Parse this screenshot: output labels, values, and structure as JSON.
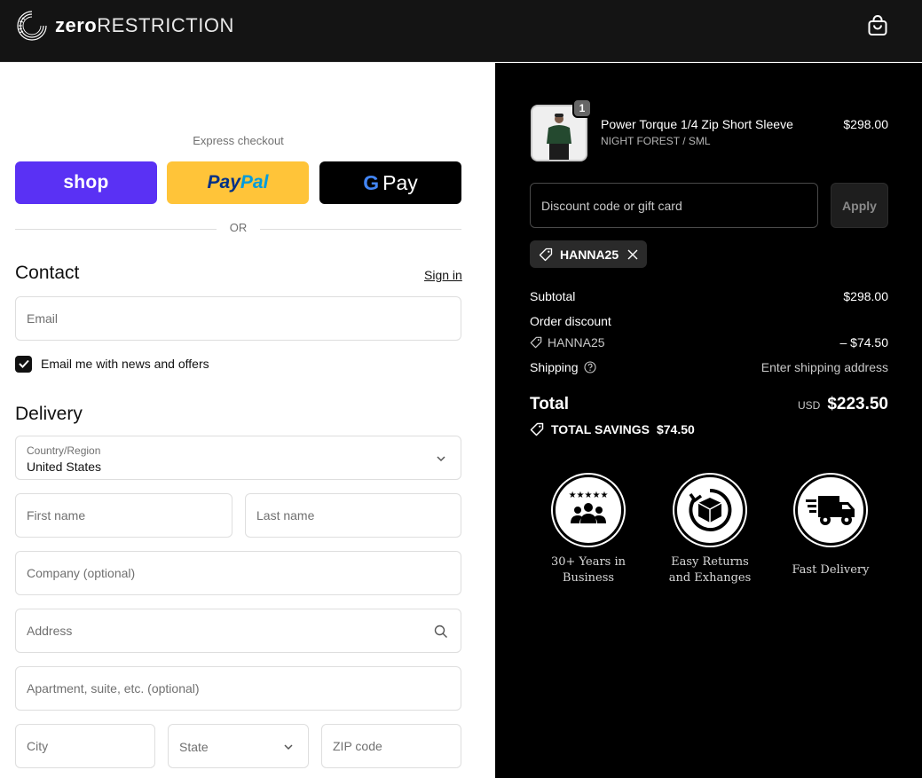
{
  "header": {
    "brand_bold": "zero",
    "brand_rest": "RESTRICTION"
  },
  "express": {
    "label": "Express checkout",
    "shop_label": "shop",
    "paypal_part1": "Pay",
    "paypal_part2": "Pal",
    "gpay_g": "G",
    "gpay_label": "Pay",
    "or": "OR"
  },
  "contact": {
    "title": "Contact",
    "signin": "Sign in",
    "email_placeholder": "Email",
    "newsletter_label": "Email me with news and offers",
    "newsletter_checked": true
  },
  "delivery": {
    "title": "Delivery",
    "country_label": "Country/Region",
    "country_value": "United States",
    "first_name_placeholder": "First name",
    "last_name_placeholder": "Last name",
    "company_placeholder": "Company (optional)",
    "address_placeholder": "Address",
    "apartment_placeholder": "Apartment, suite, etc. (optional)",
    "city_placeholder": "City",
    "state_placeholder": "State",
    "zip_placeholder": "ZIP code"
  },
  "summary": {
    "product": {
      "quantity": "1",
      "name": "Power Torque 1/4 Zip Short Sleeve",
      "variant": "NIGHT FOREST / SML",
      "price": "$298.00"
    },
    "discount_placeholder": "Discount code or gift card",
    "apply_label": "Apply",
    "applied_code": "HANNA25",
    "subtotal_label": "Subtotal",
    "subtotal_value": "$298.00",
    "order_discount_label": "Order discount",
    "discount_code": "HANNA25",
    "discount_value": "– $74.50",
    "shipping_label": "Shipping",
    "shipping_value": "Enter shipping address",
    "total_label": "Total",
    "total_currency": "USD",
    "total_value": "$223.50",
    "savings_label": "TOTAL SAVINGS",
    "savings_value": "$74.50"
  },
  "badges": [
    {
      "icon": "group-stars-icon",
      "line1": "30+ Years in",
      "line2": "Business"
    },
    {
      "icon": "box-return-icon",
      "line1": "Easy Returns",
      "line2": "and Exhanges"
    },
    {
      "icon": "truck-icon",
      "line1": "Fast Delivery",
      "line2": ""
    }
  ],
  "colors": {
    "shop": "#5a31f4",
    "paypal": "#ffc439",
    "dark": "#000000"
  }
}
